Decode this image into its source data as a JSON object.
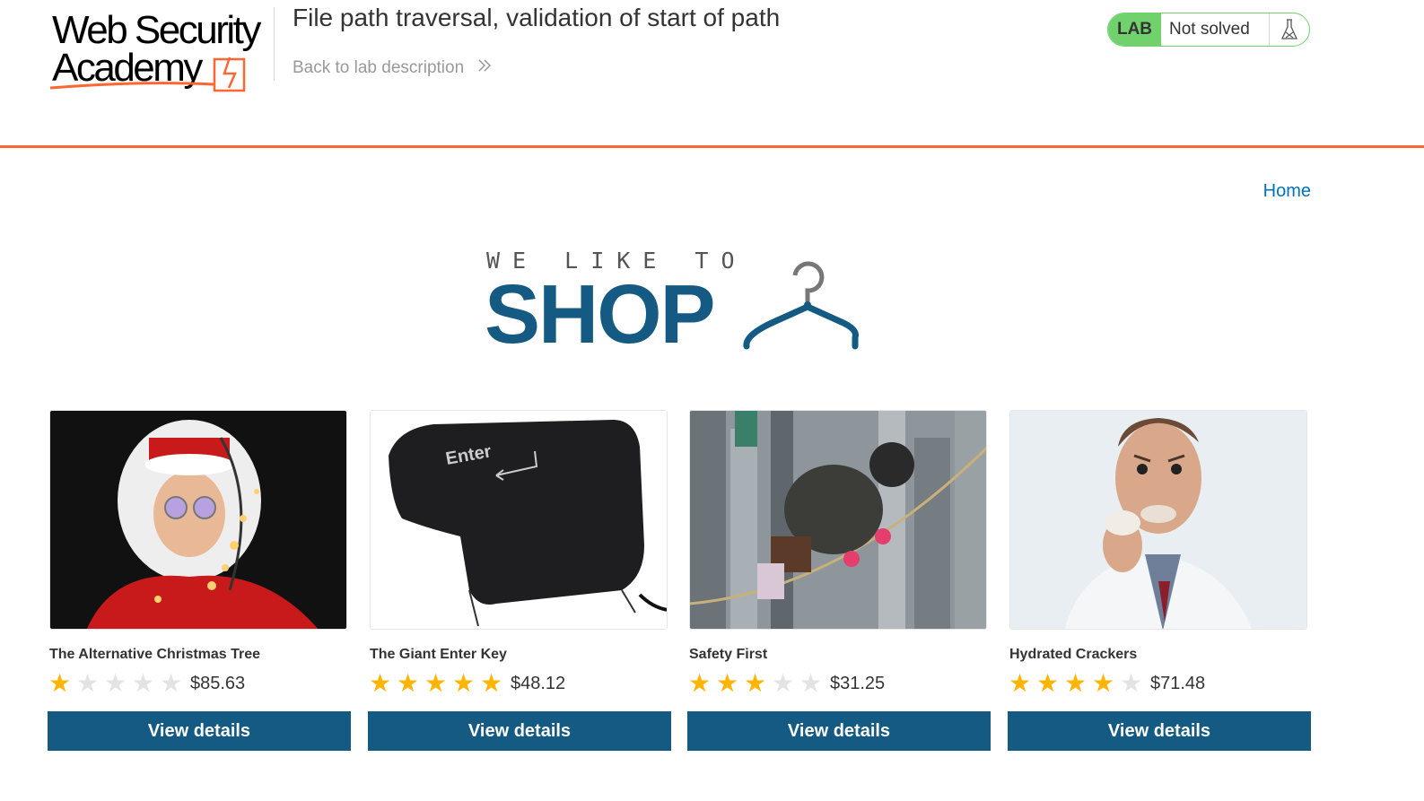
{
  "header": {
    "logo_line1": "Web Security",
    "logo_line2": "Academy",
    "lab_title": "File path traversal, validation of start of path",
    "back_link": "Back to lab description",
    "status": {
      "badge": "LAB",
      "text": "Not solved"
    }
  },
  "nav": {
    "home": "Home"
  },
  "shop_logo": {
    "tagline": "WE LIKE TO",
    "word": "SHOP"
  },
  "colors": {
    "accent": "#ff6633",
    "primary": "#145a82",
    "lab_green": "#70d16d",
    "link": "#0071bc",
    "star": "#ffb400"
  },
  "products": [
    {
      "name": "The Alternative Christmas Tree",
      "rating": 1,
      "price": "$85.63",
      "button": "View details"
    },
    {
      "name": "The Giant Enter Key",
      "rating": 5,
      "price": "$48.12",
      "button": "View details"
    },
    {
      "name": "Safety First",
      "rating": 3,
      "price": "$31.25",
      "button": "View details"
    },
    {
      "name": "Hydrated Crackers",
      "rating": 4,
      "price": "$71.48",
      "button": "View details"
    }
  ]
}
